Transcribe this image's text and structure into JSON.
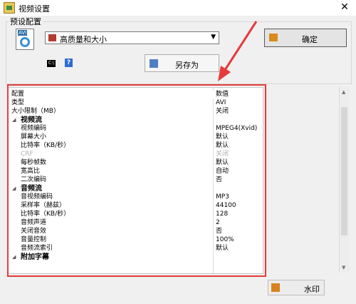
{
  "window": {
    "title": "视频设置"
  },
  "presets": {
    "group_label": "预设配置",
    "icon_text": "AVI",
    "selected": "高质量和大小",
    "ok_label": "确定",
    "save_as_label": "另存为"
  },
  "grid": {
    "header": {
      "name": "配置",
      "value": "数值"
    },
    "rows": [
      {
        "name": "类型",
        "value": "AVI"
      },
      {
        "name": "大小限制（MB）",
        "value": "关闭"
      },
      {
        "name": "视频流",
        "value": ""
      },
      {
        "name": "视频编码",
        "value": "MPEG4(Xvid)"
      },
      {
        "name": "屏幕大小",
        "value": "默认"
      },
      {
        "name": "比特率（KB/秒）",
        "value": "默认"
      },
      {
        "name": "CRF",
        "value": "关闭"
      },
      {
        "name": "每秒帧数",
        "value": "默认"
      },
      {
        "name": "宽高比",
        "value": "自动"
      },
      {
        "name": "二次编码",
        "value": "否"
      },
      {
        "name": "音频流",
        "value": ""
      },
      {
        "name": "音视频编码",
        "value": "MP3"
      },
      {
        "name": "采样率（赫兹）",
        "value": "44100"
      },
      {
        "name": "比特率（KB/秒）",
        "value": "128"
      },
      {
        "name": "音频声道",
        "value": "2"
      },
      {
        "name": "关闭音效",
        "value": "否"
      },
      {
        "name": "音量控制",
        "value": "100%"
      },
      {
        "name": "音频流索引",
        "value": "默认"
      },
      {
        "name": "附加字幕",
        "value": ""
      }
    ]
  },
  "footer": {
    "watermark_label": "水印"
  },
  "colors": {
    "highlight": "#e53b3b"
  }
}
